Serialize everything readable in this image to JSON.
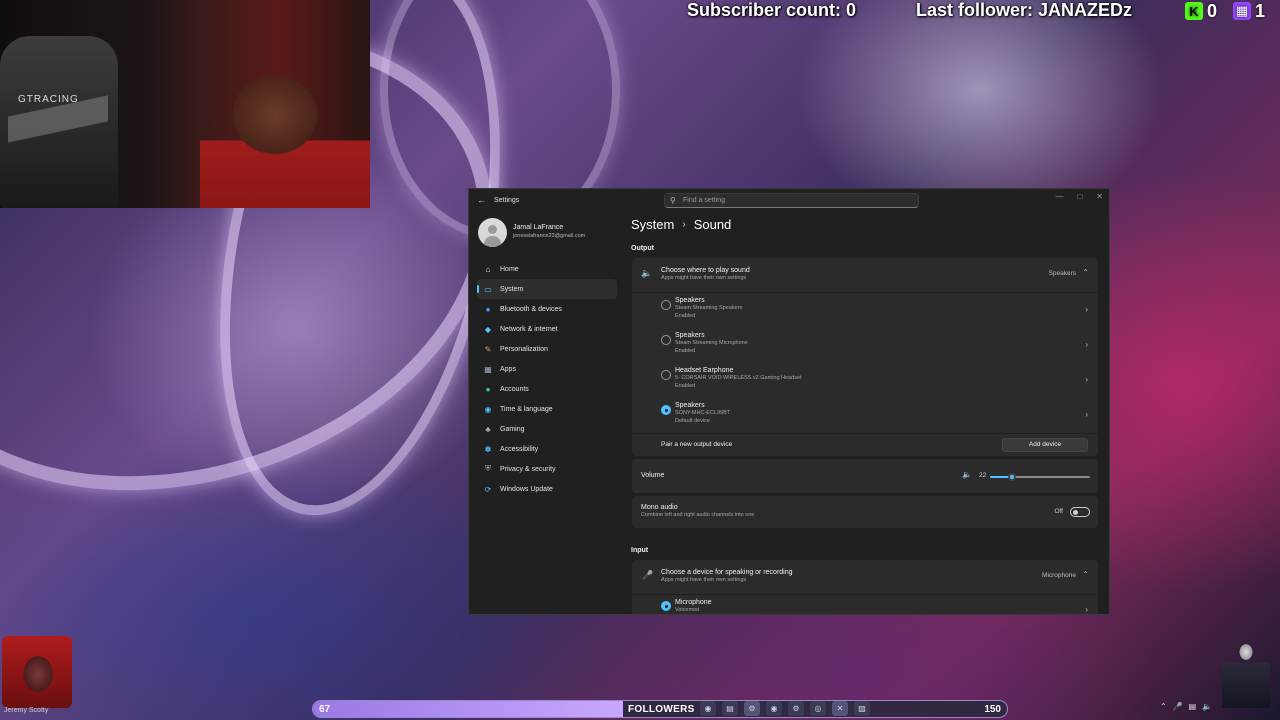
{
  "stream": {
    "subscriber_count": "Subscriber count: 0",
    "last_follower": "Last follower: JANAZEDz",
    "kick_count": "0",
    "twitch_count": "1",
    "webcam_chair_label": "GTRACING",
    "colors": {
      "kick": "#53fc18",
      "twitch": "#9146ff"
    }
  },
  "settings": {
    "title": "Settings",
    "search_placeholder": "Find a setting",
    "profile": {
      "name": "Jamal LaFrance",
      "email": "jonesslafrance23@gmail.com"
    },
    "nav": [
      {
        "label": "Home",
        "icon": "home-icon"
      },
      {
        "label": "System",
        "icon": "system-icon"
      },
      {
        "label": "Bluetooth & devices",
        "icon": "bluetooth-icon"
      },
      {
        "label": "Network & internet",
        "icon": "network-icon"
      },
      {
        "label": "Personalization",
        "icon": "brush-icon"
      },
      {
        "label": "Apps",
        "icon": "apps-icon"
      },
      {
        "label": "Accounts",
        "icon": "accounts-icon"
      },
      {
        "label": "Time & language",
        "icon": "globe-icon"
      },
      {
        "label": "Gaming",
        "icon": "gaming-icon"
      },
      {
        "label": "Accessibility",
        "icon": "accessibility-icon"
      },
      {
        "label": "Privacy & security",
        "icon": "shield-icon"
      },
      {
        "label": "Windows Update",
        "icon": "update-icon"
      }
    ],
    "breadcrumb": {
      "parent": "System",
      "current": "Sound"
    },
    "output": {
      "heading": "Output",
      "choose_title": "Choose where to play sound",
      "choose_sub": "Apps might have their own settings",
      "selected": "Speakers",
      "devices": [
        {
          "name": "Speakers",
          "detail": "Steam Streaming Speakers",
          "status": "Enabled",
          "selected": false
        },
        {
          "name": "Speakers",
          "detail": "Steam Streaming Microphone",
          "status": "Enabled",
          "selected": false
        },
        {
          "name": "Headset Earphone",
          "detail": "5- CORSAIR VOID WIRELESS v2 Gaming Headset",
          "status": "Enabled",
          "selected": false
        },
        {
          "name": "Speakers",
          "detail": "SONY-MHC-ECL99BT",
          "status": "Default device",
          "selected": true
        }
      ],
      "pair_label": "Pair a new output device",
      "add_device": "Add device",
      "volume_label": "Volume",
      "volume_value": "22",
      "volume_level": 22,
      "mono_title": "Mono audio",
      "mono_sub": "Combine left and right audio channels into one",
      "mono_state": "Off"
    },
    "input": {
      "heading": "Input",
      "choose_title": "Choose a device for speaking or recording",
      "choose_sub": "Apps might have their own settings",
      "selected": "Microphone",
      "devices": [
        {
          "name": "Microphone",
          "detail": "Voicemod",
          "selected": true
        }
      ]
    }
  },
  "followers_bar": {
    "left_value": "67",
    "label": "FOLLOWERS",
    "right_value": "150",
    "progress": 0.447
  },
  "corner": {
    "caption": "Jeremy Scotty"
  }
}
